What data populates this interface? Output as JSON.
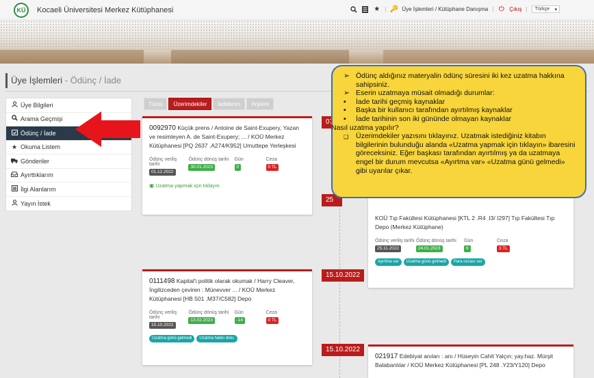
{
  "header": {
    "logo_text": "KÜ",
    "site_title": "Kocaeli Üniversitesi Merkez Kütüphanesi",
    "links": {
      "member": "Üye İşlemleri / Kütüphane Danışma",
      "logout": "Çıkış"
    },
    "language": "Türkçe"
  },
  "page": {
    "title": "Üye İşlemleri",
    "subtitle": "Ödünç / İade"
  },
  "sidebar": {
    "items": [
      {
        "label": "Üye Bilgileri",
        "icon": "user-icon"
      },
      {
        "label": "Arama Geçmişi",
        "icon": "search-icon"
      },
      {
        "label": "Ödünç / İade",
        "icon": "calendar-check-icon",
        "active": true
      },
      {
        "label": "Okuma Listem",
        "icon": "star-icon"
      },
      {
        "label": "Gönderiler",
        "icon": "truck-icon"
      },
      {
        "label": "Ayırttıklarım",
        "icon": "inbox-icon"
      },
      {
        "label": "İlgi Alanlarım",
        "icon": "list-icon"
      },
      {
        "label": "Yayın İstek",
        "icon": "user-plus-icon"
      }
    ]
  },
  "tabs": [
    {
      "label": "Tümü"
    },
    {
      "label": "Üzerimdekiler",
      "active": true
    },
    {
      "label": "Iadelerim"
    },
    {
      "label": "Arşivim"
    }
  ],
  "labels": {
    "issue_date": "Ödünç veriliş tarihi",
    "return_date": "Ödünç dönüş tarihi",
    "days": "Gün",
    "fine": "Ceza"
  },
  "dates": {
    "d1": "07",
    "d2": "25",
    "d3": "15.10.2022",
    "d4": "15.10.2022"
  },
  "cards": {
    "c1": {
      "number": "0092970",
      "title": "Küçük prens / Antoine de Saint-Exupery, Yazan ve resimleyen A. de Saint-Exupery; ... / KOÜ Merkez Kütüphanesi [PQ 2637 .A274/K952] Umuttepe Yerleşkesi",
      "issue_date": "01.12.2022",
      "return_date": "30.01.2023",
      "days": "0",
      "fine": "0 TL",
      "extend_link": "Uzatma yapmak için tıklayın."
    },
    "c2": {
      "title": "KOÜ Tıp Fakültesi Kütüphanesi [KTL 2 .R4 .I3/ I297] Tıp Fakültesi Tıp Depo (Merkez Kütüphane)",
      "issue_date": "25.11.2022",
      "return_date": "24.01.2023",
      "days": "6",
      "fine": "3 TL",
      "badges": [
        "Ayırtma var",
        "Uzatma günü gelmedi",
        "Para cezası var"
      ]
    },
    "c3": {
      "number": "0111498",
      "title": "Kapital'i politik olarak okumak / Harry Cleaver, İngilizceden çeviren : Münevver ... / KOÜ Merkez Kütüphanesi [HB 501 .M37/C582] Depo",
      "issue_date": "15.10.2022",
      "return_date": "13.02.2023",
      "days": "-14",
      "fine": "0 TL",
      "badges": [
        "Uzatma günü gelmedi",
        "Uzatma hakkı dolu."
      ]
    },
    "c4": {
      "number": "021917",
      "title": "Edebiyat anıları : anı / Hüseyin Cahit Yalçın; yay.haz. Mürşit Balabanlılar / KOÜ Merkez Kütüphanesi [PL 248 .Y23/Y120] Depo"
    }
  },
  "callout": {
    "lines": [
      {
        "bullet": "➢",
        "text": "Ödünç aldığınız materyalin ödünç süresini iki kez uzatma hakkına sahipsiniz."
      },
      {
        "bullet": "➢",
        "text": "Eserin uzatmaya müsait olmadığı durumlar:"
      },
      {
        "bullet": "▪",
        "text": "İade tarihi geçmiş kaynaklar"
      },
      {
        "bullet": "▪",
        "text": "Başka bir kullanıcı tarafından ayırtılmış kaynaklar"
      },
      {
        "bullet": "▪",
        "text": "İade tarihinin son iki gününde olmayan kaynaklar"
      },
      {
        "bullet": "",
        "text": "Nasıl uzatma yapılır?"
      },
      {
        "bullet": "❑",
        "text": "Üzerimdekiler yazısını tıklayınız. Uzatmak istediğiniz kitabın bilgilerinin bulunduğu alanda «Uzatma yapmak için tıklayın» ibaresini göreceksiniz. Eğer başkası tarafından ayırtılmış ya da uzatmaya engel bir durum mevcutsa «Ayırtma var» «Uzatma günü gelmedi» gibi uyarılar çıkar."
      }
    ]
  },
  "colors": {
    "accent": "#b91c1c",
    "callout_bg": "#f7d53b",
    "callout_border": "#3b6fb6",
    "sidebar_active": "#2b3a4a"
  }
}
